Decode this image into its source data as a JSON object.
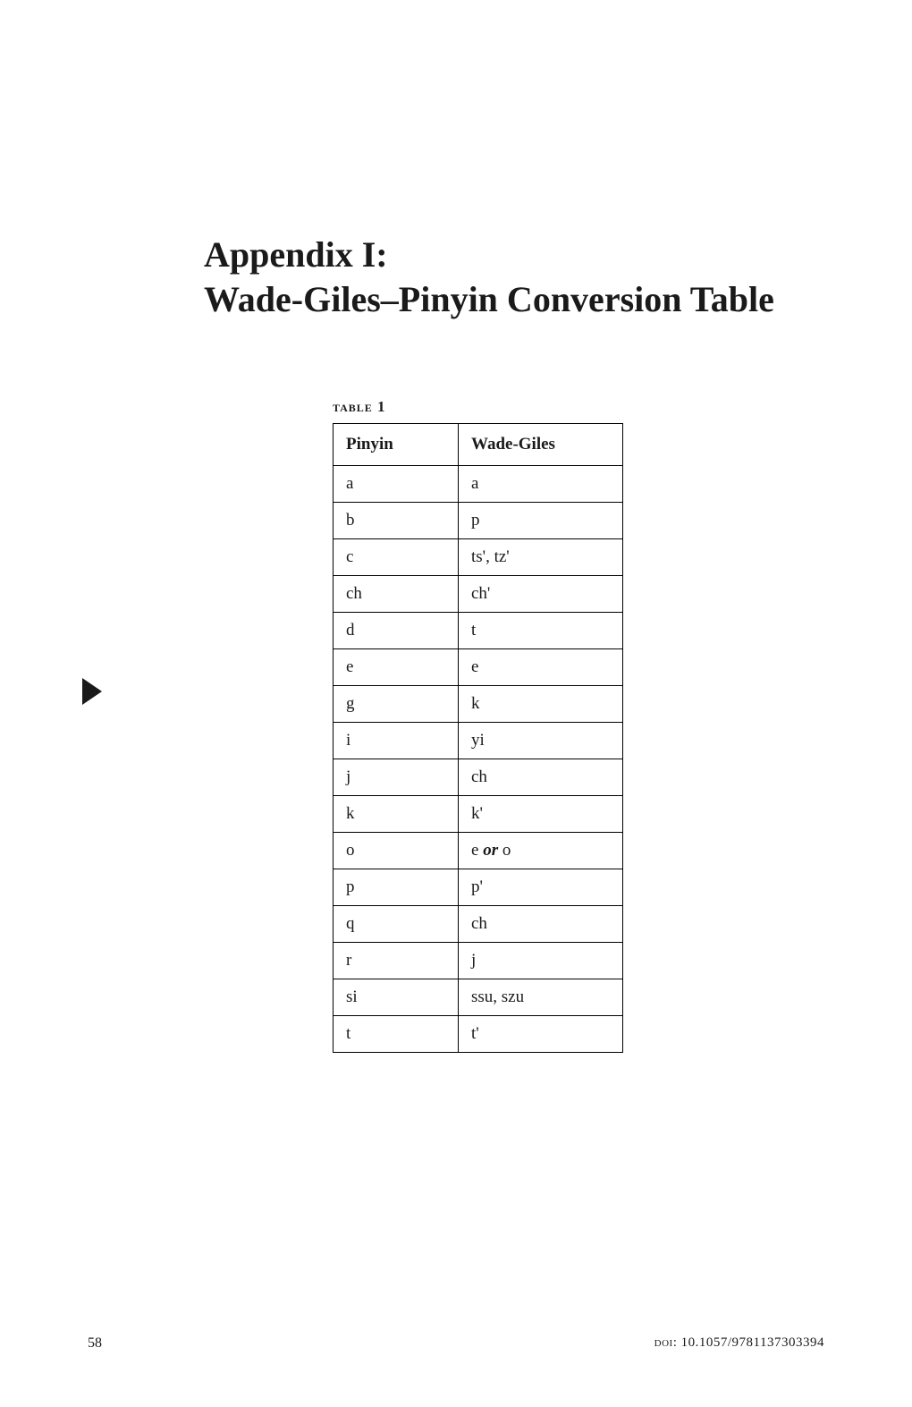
{
  "title": "Appendix I:\nWade-Giles–Pinyin Conversion Table",
  "table": {
    "caption": "table 1",
    "headers": {
      "col1": "Pinyin",
      "col2": "Wade-Giles"
    },
    "rows": [
      {
        "pinyin": "a",
        "wade_giles": "a"
      },
      {
        "pinyin": "b",
        "wade_giles": "p"
      },
      {
        "pinyin": "c",
        "wade_giles": "ts', tz'"
      },
      {
        "pinyin": "ch",
        "wade_giles": "ch'"
      },
      {
        "pinyin": "d",
        "wade_giles": "t"
      },
      {
        "pinyin": "e",
        "wade_giles": "e"
      },
      {
        "pinyin": "g",
        "wade_giles": "k"
      },
      {
        "pinyin": "i",
        "wade_giles": "yi"
      },
      {
        "pinyin": "j",
        "wade_giles": "ch"
      },
      {
        "pinyin": "k",
        "wade_giles": "k'"
      },
      {
        "pinyin": "o",
        "wade_giles_html": "e  <span class=\"italic\">or</span>  o"
      },
      {
        "pinyin": "p",
        "wade_giles": "p'"
      },
      {
        "pinyin": "q",
        "wade_giles": "ch"
      },
      {
        "pinyin": "r",
        "wade_giles": "j"
      },
      {
        "pinyin": "si",
        "wade_giles": "ssu, szu"
      },
      {
        "pinyin": "t",
        "wade_giles": "t'"
      }
    ]
  },
  "footer": {
    "page_number": "58",
    "doi": "doi: 10.1057/9781137303394"
  }
}
